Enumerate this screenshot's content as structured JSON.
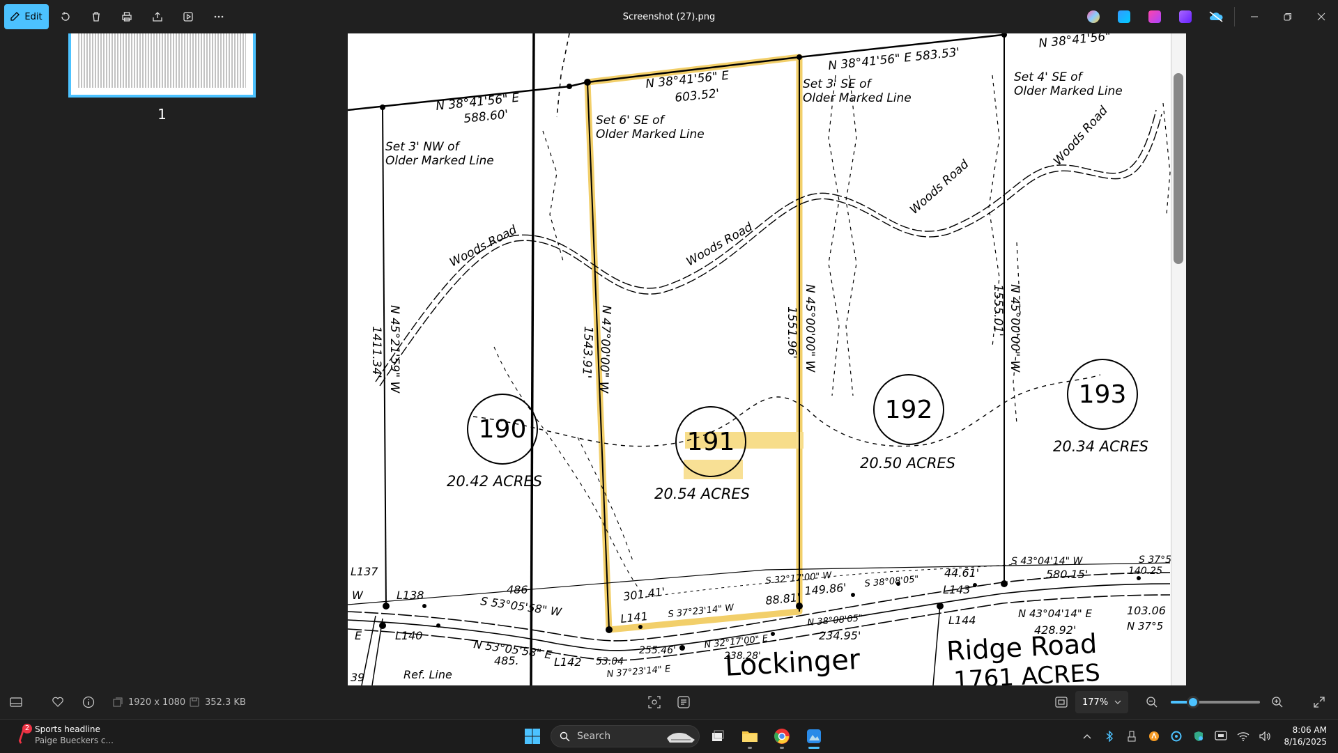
{
  "titlebar": {
    "edit_label": "Edit",
    "title": "Screenshot (27).png"
  },
  "sidebar": {
    "page_number": "1"
  },
  "statusbar": {
    "dimensions": "1920 x 1080",
    "file_size": "352.3 KB",
    "zoom": "177%",
    "zoom_fraction": 0.25
  },
  "document": {
    "bearings": {
      "top_left": "N 38°41'56\" E",
      "top_left_dist": "588.60'",
      "top_mid": "N 38°41'56\" E",
      "top_mid_dist": "603.52'",
      "top_right": "N 38°41'56\" E 583.53'",
      "top_far_right": "N 38°41'56\"",
      "left_vert": "N 45°21'59\" W",
      "left_vert_dist": "1411.34'",
      "lot191_left": "N 47°00'00\" W",
      "lot191_left_dist": "1543.91'",
      "lot191_right": "N 45°00'00\" W",
      "lot191_right_dist": "1551.96'",
      "right_vert": "N 45°00'00\" W",
      "right_vert_dist": "1555.01'"
    },
    "notes": {
      "set3nw_1": "Set 3' NW of",
      "set3nw_2": "Older Marked Line",
      "set6se_1": "Set 6' SE of",
      "set6se_2": "Older Marked Line",
      "set3se_1": "Set 3' SE of",
      "set3se_2": "Older Marked Line",
      "set4se_1": "Set 4' SE of",
      "set4se_2": "Older Marked Line"
    },
    "woods_road": "Woods Road",
    "lots": [
      {
        "number": "190",
        "acres": "20.42 ACRES"
      },
      {
        "number": "191",
        "acres": "20.54 ACRES"
      },
      {
        "number": "192",
        "acres": "20.50 ACRES"
      },
      {
        "number": "193",
        "acres": "20.34 ACRES"
      }
    ],
    "bottom": {
      "l137": "L137",
      "l138": "L138",
      "l140": "L140",
      "l141": "L141",
      "l142": "L142",
      "l143": "L143",
      "l144": "L144",
      "w1": "W",
      "e1": "E",
      "n39": "39",
      "s53_top": "S 53°05'58\" W",
      "d486": "486",
      "n53": "N 53°05'58\" E",
      "d485": "485.",
      "d301": "301.41'",
      "s37_l141": "S 37°23'14\" W",
      "d88": "88.81'",
      "s32_top": "S 32°17'00\" W",
      "d149": "149.86'",
      "s38_top": "S 38°08'05\"",
      "d44": "44.61'",
      "s43_top": "S 43°04'14\" W",
      "d580": "580.15'",
      "s37_far": "S 37°5",
      "d140": "140.25",
      "d53": "53.04",
      "n37": "N 37°23'14\" E",
      "d255": "255.46'",
      "n32": "N 32°17'00\" E",
      "d238": "238.28'",
      "n38": "N 38°08'05\"",
      "d234": "234.95'",
      "n43": "N 43°04'14\" E",
      "d428": "428.92'",
      "d103": "103.06",
      "n37b": "N 37°5",
      "ref_line": "Ref. Line",
      "lockinger": "Lockinger",
      "ridge_road": "Ridge Road",
      "acres_big": "1761 ACRES"
    }
  },
  "taskbar": {
    "news_badge": "2",
    "news_headline": "Sports headline",
    "news_sub": "Paige Bueckers c...",
    "search_placeholder": "Search",
    "time": "8:06 AM",
    "date": "8/16/2025"
  }
}
